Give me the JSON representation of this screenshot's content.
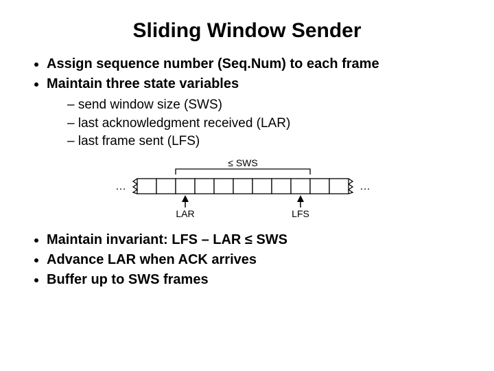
{
  "title": "Sliding Window Sender",
  "bullets_top": {
    "b1": "Assign sequence number (Seq.Num) to each frame",
    "b2": "Maintain three state variables"
  },
  "sub": {
    "s1": "send window size (SWS)",
    "s2": "last acknowledgment received (LAR)",
    "s3": "last frame sent (LFS)"
  },
  "bullets_bottom": {
    "b3": "Maintain invariant: LFS – LAR ≤ SWS",
    "b4": "Advance LAR when ACK arrives",
    "b5": "Buffer up to SWS frames"
  },
  "diagram": {
    "sws_label": "≤ SWS",
    "dots_left": "…",
    "dots_right": "…",
    "lar_label": "LAR",
    "lfs_label": "LFS",
    "cells_total": 11,
    "window_start_cell": 2,
    "window_end_cell": 8,
    "lar_cell": 2,
    "lfs_cell": 8
  }
}
